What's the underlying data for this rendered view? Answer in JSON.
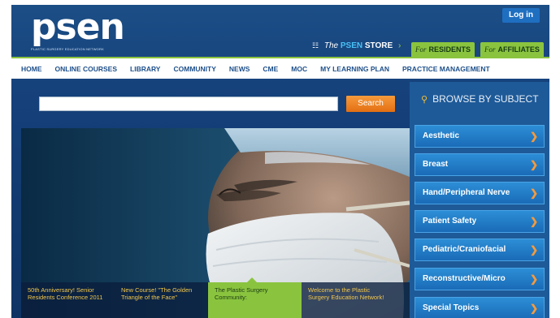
{
  "header": {
    "logo_text": "psen",
    "logo_tagline": "PLASTIC SURGERY EDUCATION NETWORK",
    "login_label": "Log in",
    "store": {
      "prefix": "The",
      "highlight": "PSEN",
      "suffix": "STORE"
    },
    "residents": {
      "prefix": "For",
      "label": "RESIDENTS"
    },
    "affiliates": {
      "prefix": "For",
      "label": "AFFILIATES"
    }
  },
  "nav": {
    "items": [
      "HOME",
      "ONLINE COURSES",
      "LIBRARY",
      "COMMUNITY",
      "NEWS",
      "CME",
      "MOC",
      "MY LEARNING PLAN",
      "PRACTICE MANAGEMENT"
    ]
  },
  "search": {
    "placeholder": "",
    "button_label": "Search"
  },
  "hero": {
    "tabs": [
      "50th Anniversary! Senior Residents Conference 2011",
      "New Course! \"The Golden Triangle of the Face\"",
      "The Plastic Surgery Community:",
      "Welcome to the Plastic Surgery Education Network!"
    ],
    "active_tab": 2
  },
  "sidebar": {
    "title": "BROWSE BY SUBJECT",
    "subjects": [
      "Aesthetic",
      "Breast",
      "Hand/Peripheral Nerve",
      "Patient Safety",
      "Pediatric/Craniofacial",
      "Reconstructive/Micro",
      "Special Topics"
    ]
  },
  "colors": {
    "brand_blue": "#1c4e86",
    "accent_green": "#8ac43f",
    "search_orange": "#e26f12",
    "subject_blue": "#1a6bb7"
  },
  "icons": {
    "cart": "cart-icon",
    "magnifier": "search-icon",
    "chevron": "chevron-right-icon",
    "arrow": "arrow-right-icon"
  }
}
